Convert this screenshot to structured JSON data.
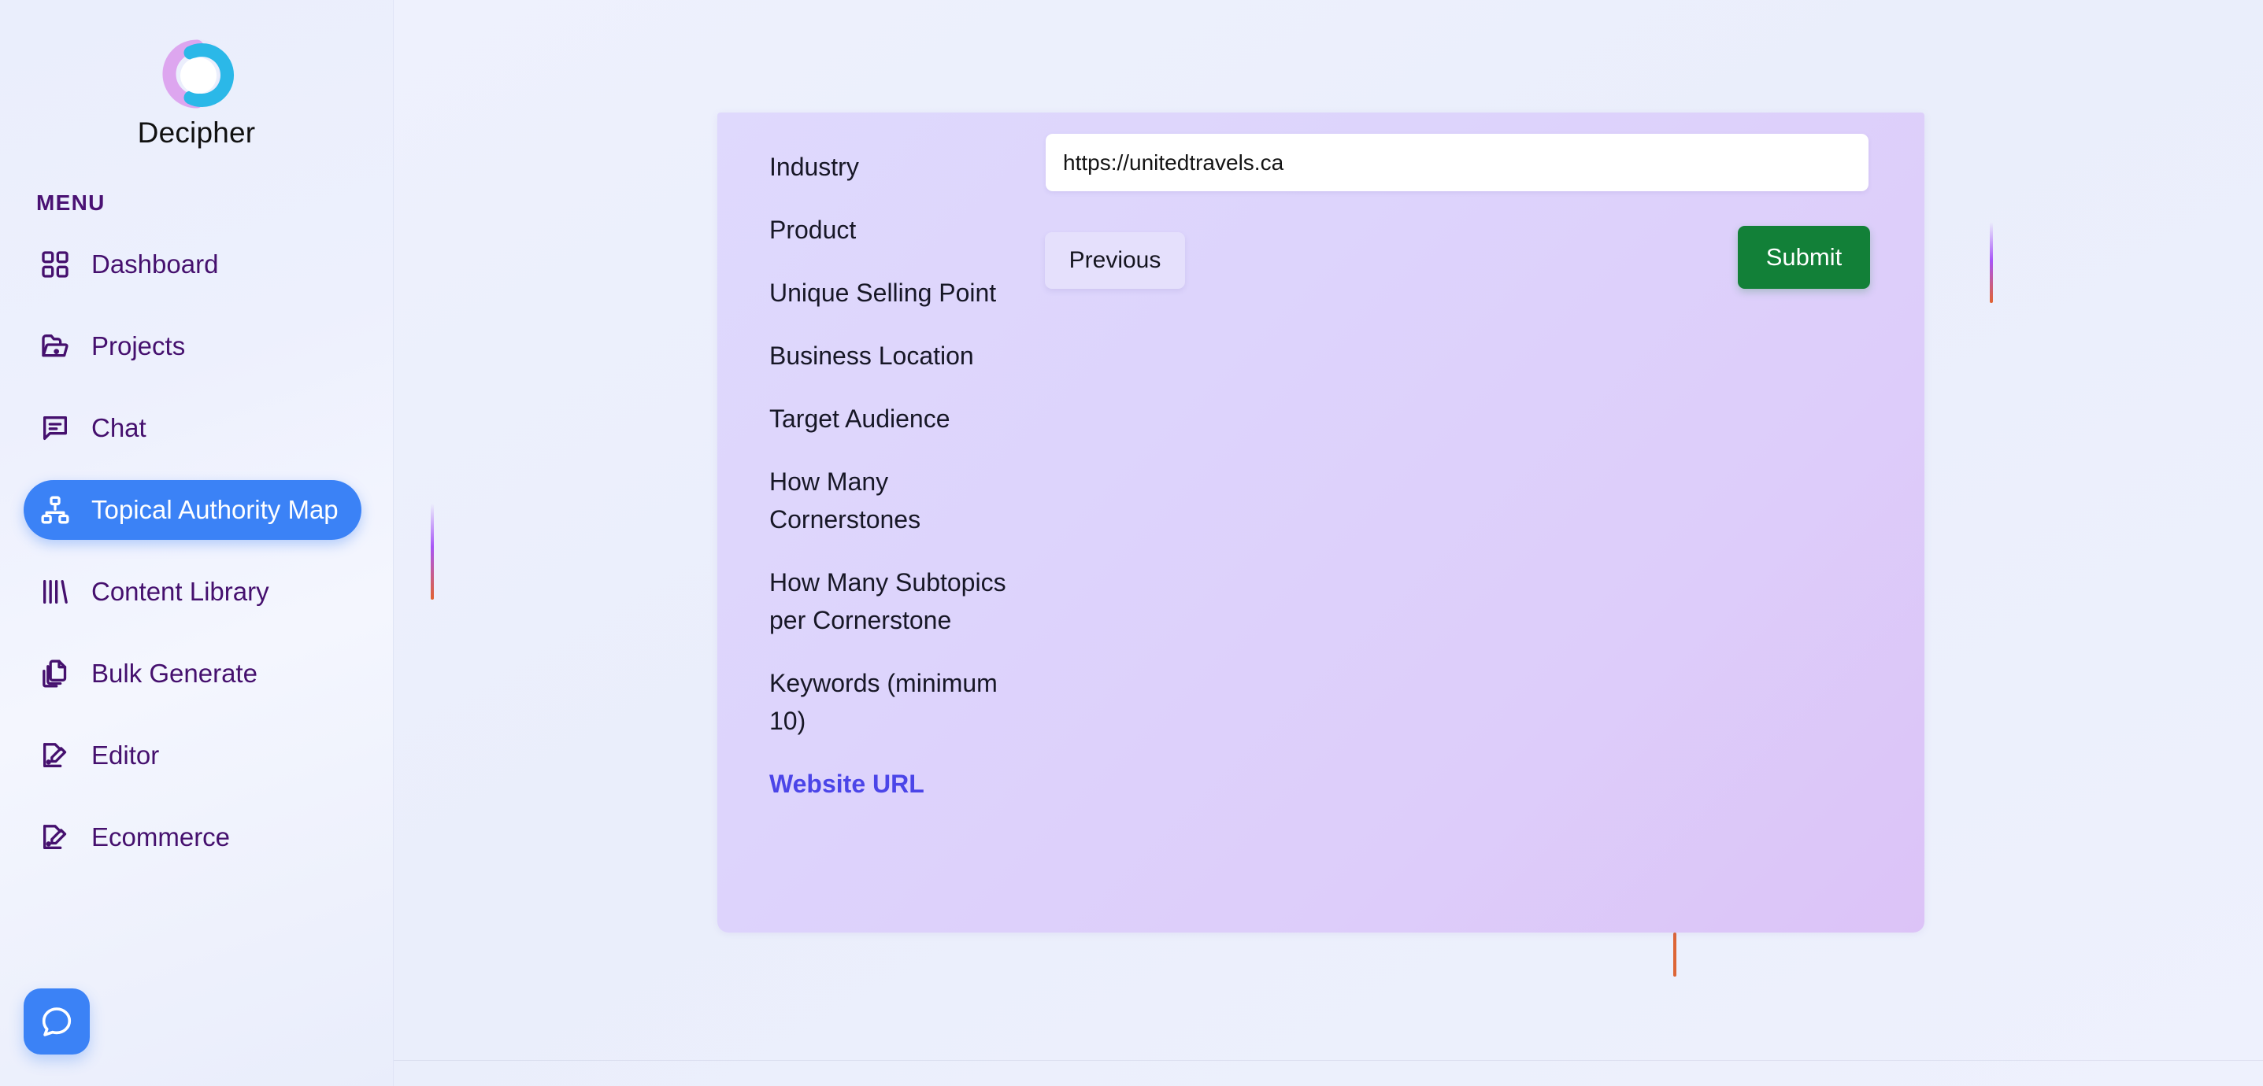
{
  "brand": {
    "name": "Decipher",
    "logo_icon": "decipher-ring-logo",
    "logo_colors": {
      "pink": "#d9a3ee",
      "blue": "#2bb8e8"
    }
  },
  "sidebar": {
    "section_label": "MENU",
    "active_color": "#3b82f6",
    "text_color": "#45106e",
    "items": [
      {
        "label": "Dashboard",
        "icon": "grid-icon",
        "active": false
      },
      {
        "label": "Projects",
        "icon": "folder-icon",
        "active": false
      },
      {
        "label": "Chat",
        "icon": "message-icon",
        "active": false
      },
      {
        "label": "Topical Authority Map",
        "icon": "sitemap-icon",
        "active": true
      },
      {
        "label": "Content Library",
        "icon": "books-icon",
        "active": false
      },
      {
        "label": "Bulk Generate",
        "icon": "copy-files-icon",
        "active": false
      },
      {
        "label": "Editor",
        "icon": "document-edit-icon",
        "active": false
      },
      {
        "label": "Ecommerce",
        "icon": "document-edit-icon",
        "active": false
      }
    ],
    "chat_fab": {
      "icon": "chat-bubble-icon",
      "color": "#3b82f6"
    }
  },
  "panel": {
    "clipped_top_text": "",
    "accent_active": "#4b45e8",
    "background_start": "#dfd9fd",
    "background_end": "#dcc3f7",
    "field_labels": [
      {
        "text": "Industry",
        "active": false
      },
      {
        "text": "Product",
        "active": false
      },
      {
        "text": "Unique Selling Point",
        "active": false
      },
      {
        "text": "Business Location",
        "active": false
      },
      {
        "text": "Target Audience",
        "active": false
      },
      {
        "text": "How Many Cornerstones",
        "active": false
      },
      {
        "text": "How Many Subtopics per Cornerstone",
        "active": false
      },
      {
        "text": "Keywords (minimum 10)",
        "active": false
      },
      {
        "text": "Website URL",
        "active": true
      }
    ],
    "url_field": {
      "value": "https://unitedtravels.ca",
      "placeholder": "https://"
    },
    "previous_button": "Previous",
    "submit_button": "Submit",
    "submit_color": "#128038"
  }
}
